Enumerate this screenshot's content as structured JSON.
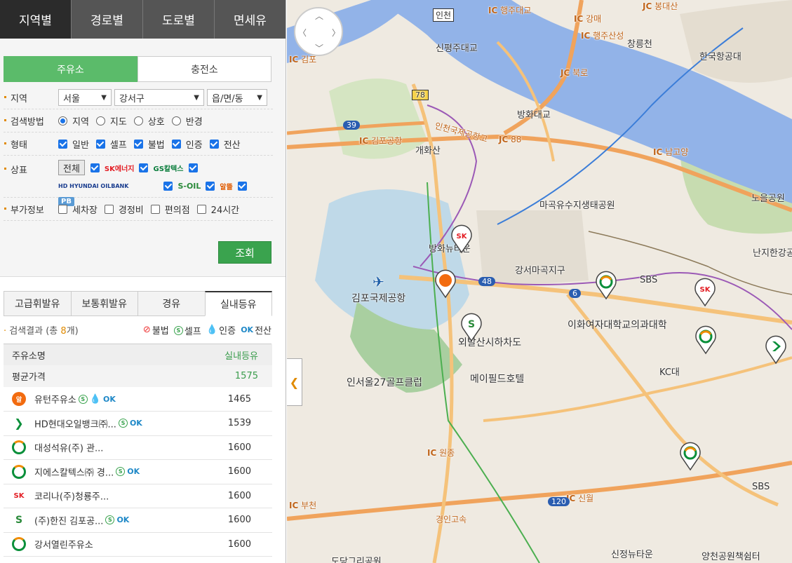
{
  "top_tabs": [
    "지역별",
    "경로별",
    "도로별",
    "면세유"
  ],
  "sub_tabs": [
    "주유소",
    "충전소"
  ],
  "filters": {
    "region_label": "지역",
    "sido": "서울",
    "sigungu": "강서구",
    "dong": "읍/면/동",
    "method_label": "검색방법",
    "methods": [
      "지역",
      "지도",
      "상호",
      "반경"
    ],
    "type_label": "형태",
    "types": [
      "일반",
      "셀프",
      "불법",
      "인증",
      "전산"
    ],
    "brand_label": "상표",
    "brand_all": "전체",
    "brands": [
      "SK에너지",
      "GS칼텍스",
      "HD HYUNDAI OILBANK",
      "S-OIL",
      "알뜰",
      "PB"
    ],
    "extra_label": "부가정보",
    "extras": [
      "세차장",
      "경정비",
      "편의점",
      "24시간"
    ],
    "search_button": "조회"
  },
  "fuel_tabs": [
    "고급휘발유",
    "보통휘발유",
    "경유",
    "실내등유"
  ],
  "result": {
    "prefix": "검색결과 (총 ",
    "count": "8",
    "suffix": "개)",
    "legend": [
      "불법",
      "셀프",
      "인증",
      "전산"
    ]
  },
  "table": {
    "col_name": "주유소명",
    "col_price": "실내등유",
    "avg_label": "평균가격",
    "avg_price": "1575",
    "rows": [
      {
        "name": "유턴주유소",
        "price": "1465"
      },
      {
        "name": "HD현대오일뱅크㈜...",
        "price": "1539"
      },
      {
        "name": "대성석유(주) 관...",
        "price": "1600"
      },
      {
        "name": "지에스칼텍스㈜ 경...",
        "price": "1600"
      },
      {
        "name": "코리나(주)청룡주...",
        "price": "1600"
      },
      {
        "name": "(주)한진 김포공...",
        "price": "1600"
      },
      {
        "name": "강서열린주유소",
        "price": "1600"
      }
    ]
  },
  "map": {
    "labels": {
      "airport": "김포국제공항",
      "golf": "인서울27골프클럽",
      "ecopark": "마곡유수지생태공원",
      "magok": "강서마곡지구",
      "ewha": "이화여자대학교의과대학",
      "oebalsan": "외발산시하차도",
      "mayfield": "메이필드호텔",
      "banghwa_bridge": "방화대교",
      "banghwa_nyu": "방화뉴타운",
      "gaehwasan": "개화산",
      "sinpyeong": "신평주대교",
      "hangul": "한국항공대",
      "noeul": "노을공원",
      "nanji": "난지한강공",
      "changryeong": "창릉천",
      "sbs1": "SBS",
      "sbs2": "SBS",
      "kc": "KC대",
      "sinjeong": "신정뉴타운",
      "yangcheon": "양천공원책쉼터",
      "doan": "도당그리공원",
      "gyeongin": "경인고속",
      "incheon": "인천",
      "ic_gimpo": "김포공항",
      "ic_88": "88",
      "ic_bukro": "북로",
      "ic_namgoyang": "남고양",
      "ic_wonjong": "원종",
      "ic_sinwol": "신월",
      "ic_bucheon": "부천",
      "ic_haengju": "행주대교",
      "ic_gangmae": "강매",
      "ic_haengjusanseong": "행주산성",
      "ic_bongdae": "봉대산",
      "ic_gimpo_top": "김포",
      "road_78": "78",
      "road_39": "39",
      "road_48": "48",
      "road_6": "6",
      "road_120": "120",
      "expressway_name": "인천국제공항고"
    },
    "colors": {
      "water": "#92b3e8",
      "land": "#efeae1",
      "road_major": "#f5c27a",
      "road_express": "#f0a35c",
      "green": "#c7dcb0",
      "airport": "#bfd9e8"
    }
  }
}
